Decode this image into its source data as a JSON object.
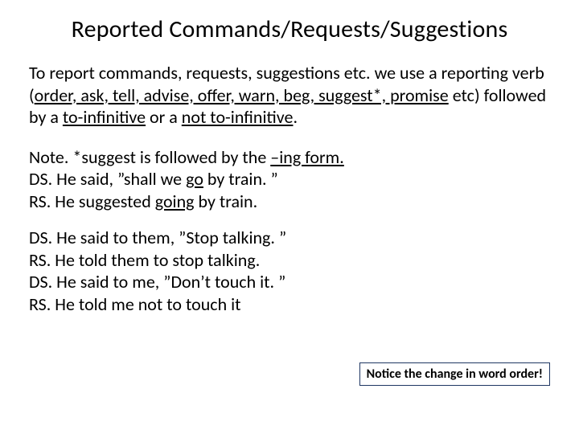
{
  "title": "Reported Commands/Requests/Suggestions",
  "intro": {
    "pre": "To report commands, requests, suggestions etc. we use a reporting verb (",
    "verbs": "order, ask, tell, advise, offer, warn, beg, suggest*, promise",
    "mid1": " etc) followed by a ",
    "toinf": "to-infinitive",
    "mid2": " or a ",
    "nottoinf": "not to-infinitive",
    "end": "."
  },
  "note": {
    "line1a": "Note. *suggest is followed by the ",
    "ingform": "–ing form.",
    "ds1a": "DS.  He said, ”shall we ",
    "go": "go",
    "ds1b": " by train. ”",
    "rs1a": "RS.  He suggested ",
    "going": "going",
    "rs1b": " by train."
  },
  "ex2": {
    "ds1": "DS.  He said to them, ”Stop talking. ”",
    "rs1": "RS.  He told them to stop talking.",
    "ds2": "DS.  He said to me, ”Don’t touch it. ”",
    "rs2": "RS.   He told me not to touch it"
  },
  "callout": "Notice the change in word order!"
}
